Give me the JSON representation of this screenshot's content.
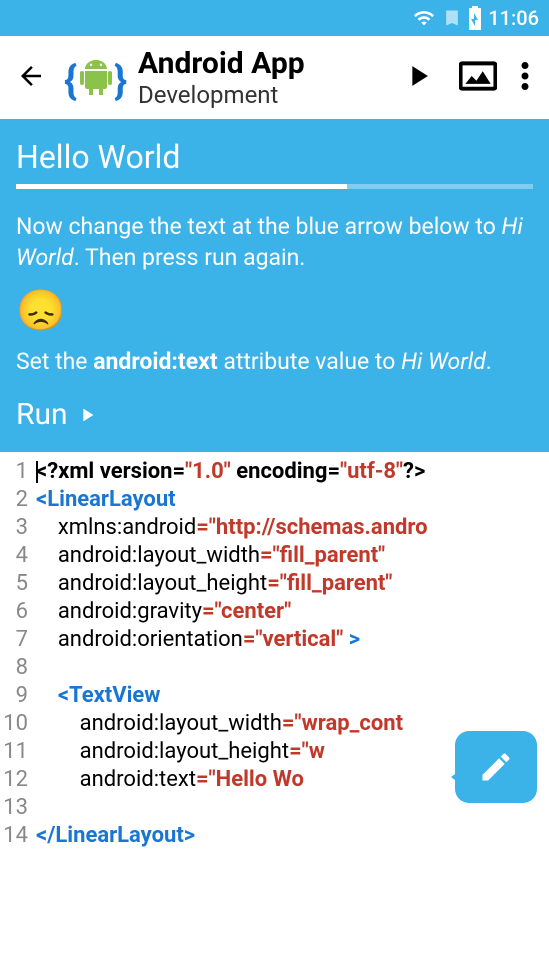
{
  "status": {
    "time": "11:06"
  },
  "header": {
    "title1": "Android App",
    "title2": "Development"
  },
  "lesson": {
    "title": "Hello World",
    "text_before_italic": "Now change the text at the blue arrow below to ",
    "text_italic": "Hi World",
    "text_after_italic": ". Then press run again.",
    "emoji": "😞",
    "hint_prefix": "Set the ",
    "hint_bold": "android:text",
    "hint_mid": " attribute value to ",
    "hint_italic": "Hi World",
    "hint_suffix": ".",
    "run_label": "Run"
  },
  "code": {
    "lines": [
      {
        "n": "1",
        "html": "<span class='xmlhead'>&lt;?xml version=</span><span class='str'>\"1.0\"</span><span class='xmlhead'> encoding=</span><span class='str'>\"utf-8\"</span><span class='xmlhead'>?&gt;</span>"
      },
      {
        "n": "2",
        "html": "<span class='bracket'>&lt;</span><span class='tag'>LinearLayout</span>"
      },
      {
        "n": "3",
        "html": "    <span class='attr'>xmlns:android</span><span class='punc'>=</span><span class='str'>\"http://schemas.andro</span>"
      },
      {
        "n": "4",
        "html": "    <span class='attr'>android:layout_width</span><span class='punc'>=</span><span class='str'>\"fill_parent\"</span>"
      },
      {
        "n": "5",
        "html": "    <span class='attr'>android:layout_height</span><span class='punc'>=</span><span class='str'>\"fill_parent\"</span>"
      },
      {
        "n": "6",
        "html": "    <span class='attr'>android:gravity</span><span class='punc'>=</span><span class='str'>\"center\"</span>"
      },
      {
        "n": "7",
        "html": "    <span class='attr'>android:orientation</span><span class='punc'>=</span><span class='str'>\"vertical\"</span> <span class='bracket'>&gt;</span>"
      },
      {
        "n": "8",
        "html": ""
      },
      {
        "n": "9",
        "html": "    <span class='bracket'>&lt;</span><span class='tag'>TextView</span>"
      },
      {
        "n": "10",
        "html": "        <span class='attr'>android:layout_width</span><span class='punc'>=</span><span class='str'>\"wrap_cont</span>"
      },
      {
        "n": "11",
        "html": "        <span class='attr'>android:layout_height</span><span class='punc'>=</span><span class='str'>\"w</span>"
      },
      {
        "n": "12",
        "html": "        <span class='attr'>android:text</span><span class='punc'>=</span><span class='str'>\"Hello Wo</span>"
      },
      {
        "n": "13",
        "html": ""
      },
      {
        "n": "14",
        "html": "<span class='bracket'>&lt;/</span><span class='tag'>LinearLayout</span><span class='bracket'>&gt;</span>"
      }
    ]
  }
}
